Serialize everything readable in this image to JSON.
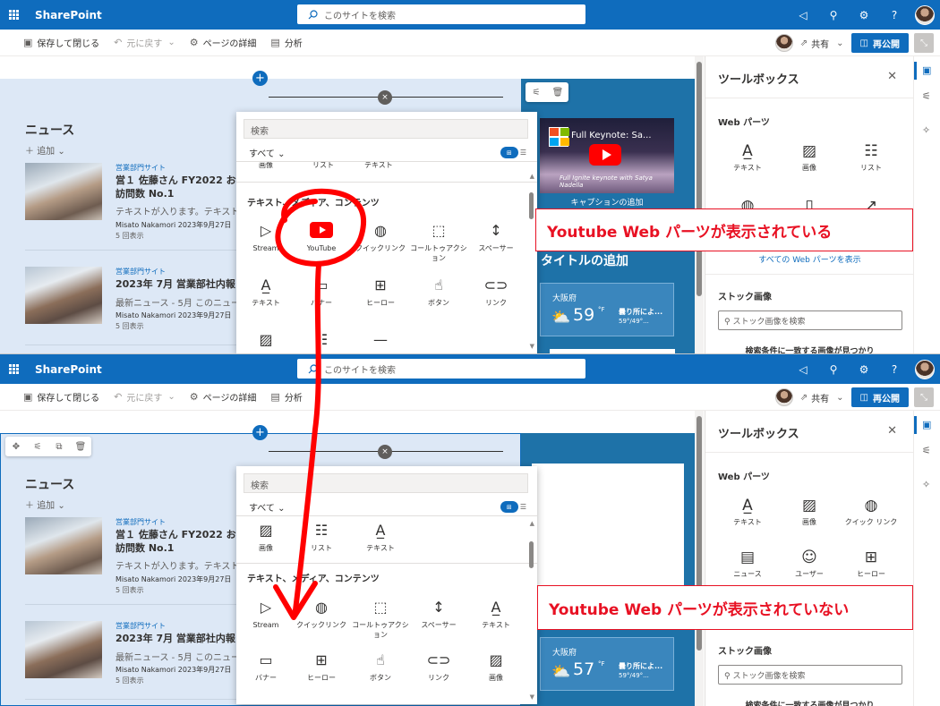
{
  "suite": {
    "app_name": "SharePoint",
    "search_placeholder": "このサイトを検索"
  },
  "commands": {
    "save_close": "保存して閉じる",
    "undo": "元に戻す",
    "page_details": "ページの詳細",
    "analytics": "分析",
    "share": "共有",
    "republish": "再公開"
  },
  "news": {
    "title": "ニュース",
    "add": "追加",
    "items": [
      {
        "site": "営業部門サイト",
        "headline": "営１ 佐藤さん FY2022 お客様訪問数 No.1",
        "description": "テキストが入ります。テキスト",
        "author_date": "Misato Nakamori 2023年9月27日",
        "views": "5 回表示"
      },
      {
        "site": "営業部門サイト",
        "headline": "2023年 7月 営業部社内報",
        "description": "最新ニュース - 5月 このニュー",
        "author_date": "Misato Nakamori 2023年9月27日",
        "views": "5 回表示"
      }
    ]
  },
  "video": {
    "title": "Full Keynote: Sa...",
    "subtitle": "Full Ignite keynote with Satya Nadella",
    "caption_add": "キャプションの追加"
  },
  "right_section": {
    "title_add": "タイトルの追加"
  },
  "weather": {
    "top": {
      "city": "大阪府",
      "temp": "59",
      "unit": "°F",
      "desc": "曇り所によ...",
      "range": "59°/49°..."
    },
    "bottom": {
      "city": "大阪府",
      "temp": "57",
      "unit": "°F",
      "desc": "曇り所によ...",
      "range": "59°/49°..."
    }
  },
  "picker": {
    "search_placeholder": "検索",
    "filter": "すべて",
    "category": "テキスト、メディア、コンテンツ",
    "top_prev_row": [
      "画像",
      "リスト",
      "テキスト"
    ],
    "top_tiles": [
      {
        "icon": "stream-icon",
        "label": "Stream"
      },
      {
        "icon": "youtube-icon",
        "label": "YouTube"
      },
      {
        "icon": "globe-icon",
        "label": "クイックリンク"
      },
      {
        "icon": "call-to-action-icon",
        "label": "コールトゥアクション"
      },
      {
        "icon": "spacer-icon",
        "label": "スペーサー"
      },
      {
        "icon": "text-icon",
        "label": "テキスト"
      },
      {
        "icon": "banner-icon",
        "label": "バナー"
      },
      {
        "icon": "hero-icon",
        "label": "ヒーロー"
      },
      {
        "icon": "button-icon",
        "label": "ボタン"
      },
      {
        "icon": "link-icon",
        "label": "リンク"
      }
    ],
    "bottom_prev_row": [
      "画像",
      "リスト",
      "テキスト"
    ],
    "bottom_tiles": [
      {
        "icon": "stream-icon",
        "label": "Stream"
      },
      {
        "icon": "globe-icon",
        "label": "クイックリンク"
      },
      {
        "icon": "call-to-action-icon",
        "label": "コールトゥアクション"
      },
      {
        "icon": "spacer-icon",
        "label": "スペーサー"
      },
      {
        "icon": "text-icon",
        "label": "テキスト"
      },
      {
        "icon": "banner-icon",
        "label": "バナー"
      },
      {
        "icon": "hero-icon",
        "label": "ヒーロー"
      },
      {
        "icon": "button-icon",
        "label": "ボタン"
      },
      {
        "icon": "link-icon",
        "label": "リンク"
      },
      {
        "icon": "image-icon",
        "label": "画像"
      }
    ]
  },
  "toolbox": {
    "title": "ツールボックス",
    "webparts_heading": "Web パーツ",
    "top_tiles": [
      "テキスト",
      "画像",
      "リスト"
    ],
    "bottom_tiles": [
      "テキスト",
      "画像",
      "クイック リンク",
      "ニュース",
      "ユーザー",
      "ヒーロー"
    ],
    "show_all": "すべての Web パーツを表示",
    "stock_heading": "ストック画像",
    "stock_search_placeholder": "ストック画像を検索",
    "no_results": "検索条件に一致する画像が見つかり"
  },
  "annotations": {
    "shown": "Youtube Web パーツが表示されている",
    "not_shown": "Youtube Web パーツが表示されていない",
    "color": "#e81123"
  },
  "colors": {
    "suite_bar": "#0f6cbd",
    "section_left": "#dde8f6",
    "section_right": "#1e72a8"
  }
}
